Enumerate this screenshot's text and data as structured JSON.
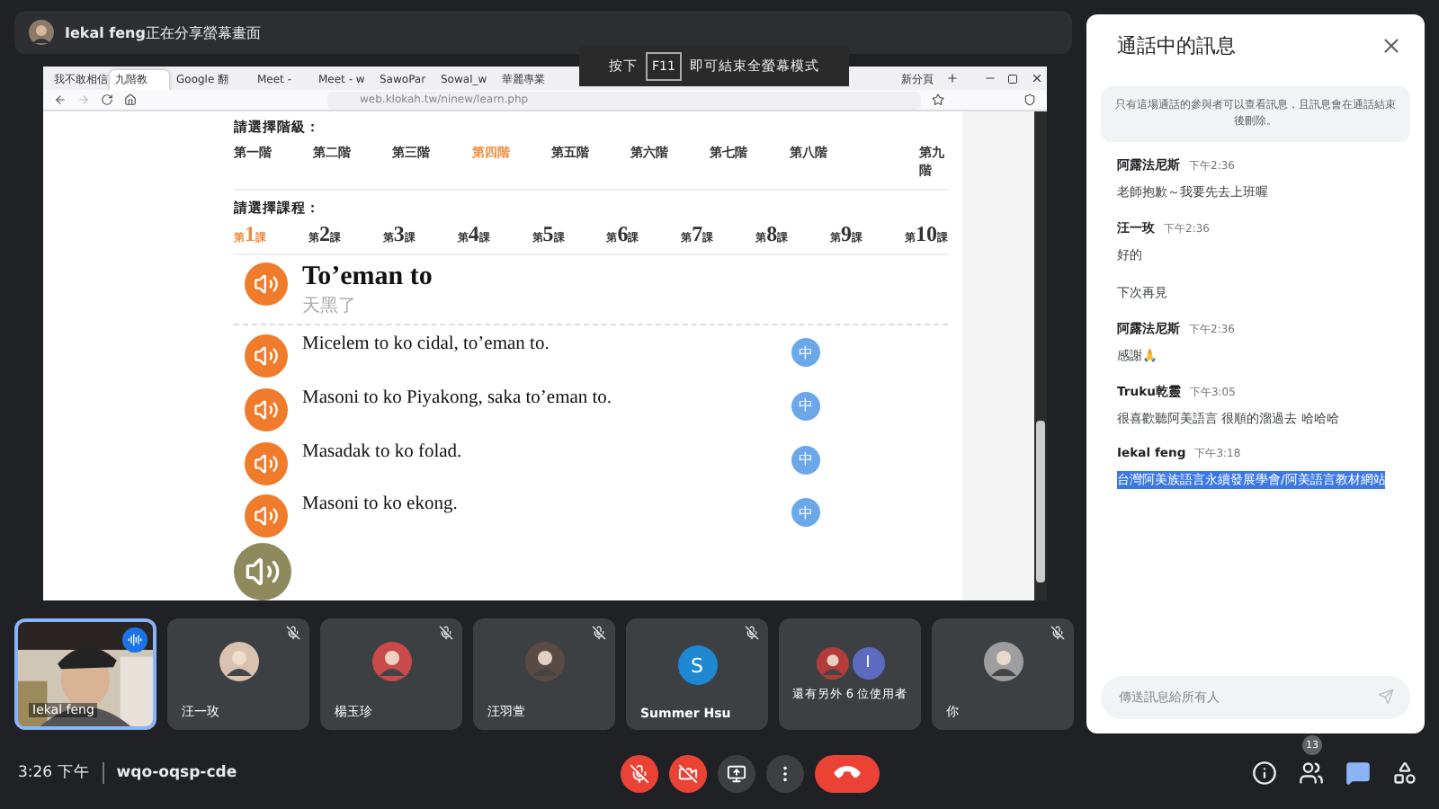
{
  "banner": {
    "text": "**Iekal feng**正在分享螢幕畫面"
  },
  "fullscreen_hint": {
    "before": "按下",
    "key": "F11",
    "after": "即可結束全螢幕模式"
  },
  "browser": {
    "tabs": [
      {
        "label": "我不敢相信",
        "selected": false
      },
      {
        "label": "九階教",
        "selected": true
      },
      {
        "label": "Google 翻",
        "selected": false
      },
      {
        "label": "Meet -",
        "selected": false
      },
      {
        "label": "Meet - w",
        "selected": false
      },
      {
        "label": "SawoPar",
        "selected": false
      },
      {
        "label": "Sowal_w",
        "selected": false
      },
      {
        "label": "華麗專業",
        "selected": false
      },
      {
        "label": "新分頁",
        "selected": false
      }
    ],
    "url": "web.klokah.tw/ninew/learn.php"
  },
  "lesson_page": {
    "level_prompt": "請選擇階級：",
    "levels": [
      {
        "label": "第一階",
        "selected": false
      },
      {
        "label": "第二階",
        "selected": false
      },
      {
        "label": "第三階",
        "selected": false
      },
      {
        "label": "第四階",
        "selected": true
      },
      {
        "label": "第五階",
        "selected": false
      },
      {
        "label": "第六階",
        "selected": false
      },
      {
        "label": "第七階",
        "selected": false
      },
      {
        "label": "第八階",
        "selected": false
      },
      {
        "label": "第九階",
        "selected": false
      }
    ],
    "course_prompt": "請選擇課程：",
    "courses": [
      {
        "label": "第1課",
        "selected": true
      },
      {
        "label": "第2課",
        "selected": false
      },
      {
        "label": "第3課",
        "selected": false
      },
      {
        "label": "第4課",
        "selected": false
      },
      {
        "label": "第5課",
        "selected": false
      },
      {
        "label": "第6課",
        "selected": false
      },
      {
        "label": "第7課",
        "selected": false
      },
      {
        "label": "第8課",
        "selected": false
      },
      {
        "label": "第9課",
        "selected": false
      },
      {
        "label": "第10課",
        "selected": false
      }
    ],
    "title": "To’eman to",
    "translation": "天黑了",
    "sentences": [
      {
        "text": "Micelem to ko cidal, to’eman to.",
        "translate": "中"
      },
      {
        "text": "Masoni to ko Piyakong, saka to’eman to.",
        "translate": "中"
      },
      {
        "text": "Masadak to ko folad.",
        "translate": "中"
      },
      {
        "text": "Masoni to ko ekong.",
        "translate": "中"
      }
    ]
  },
  "participants": [
    {
      "kind": "video",
      "name": "Iekal feng",
      "muted": false,
      "selected": true
    },
    {
      "name": "汪一玫",
      "muted": true,
      "selected": false,
      "color": "#d9c2b0"
    },
    {
      "name": "楊玉珍",
      "muted": true,
      "selected": false,
      "color": "#c94a4a"
    },
    {
      "name": "汪羽萱",
      "muted": true,
      "selected": false,
      "color": "#5a4a44"
    },
    {
      "kind": "initial",
      "name": "Summer Hsu",
      "initial": "S",
      "muted": true,
      "selected": false,
      "color": "#1e88d2"
    },
    {
      "kind": "group",
      "name": "還有另外 6 位使用者",
      "initial": "I",
      "muted": false,
      "selected": false,
      "color": "#5c6bc0"
    },
    {
      "name": "你",
      "muted": true,
      "selected": false,
      "color": "#9e9e9e"
    }
  ],
  "chat": {
    "title": "通話中的訊息",
    "notice": "只有這場通話的參與者可以查看訊息，且訊息會在通話結束後刪除。",
    "messages": [
      {
        "sender": "阿露法尼斯",
        "time": "下午2:36",
        "lines": [
          "老師抱歉～我要先去上班喔"
        ],
        "highlighted": false
      },
      {
        "sender": "汪一玫",
        "time": "下午2:36",
        "lines": [
          "好的",
          "下次再見"
        ],
        "highlighted": false
      },
      {
        "sender": "阿露法尼斯",
        "time": "下午2:36",
        "lines": [
          "感謝🙏"
        ],
        "highlighted": false
      },
      {
        "sender": "Truku乾靈",
        "time": "下午3:05",
        "lines": [
          "很喜歡聽阿美語言 很順的溜過去 哈哈哈"
        ],
        "highlighted": false
      },
      {
        "sender": "Iekal feng",
        "time": "下午3:18",
        "lines": [
          "台灣阿美族語言永續發展學會/阿美語言教材網站"
        ],
        "highlighted": true
      }
    ],
    "placeholder": "傳送訊息給所有人"
  },
  "footer": {
    "time": "3:26 下午",
    "meeting_code": "wqo-oqsp-cde",
    "controls": [
      {
        "kind": "mic",
        "on": false
      },
      {
        "kind": "camera",
        "on": false
      },
      {
        "kind": "present"
      },
      {
        "kind": "more"
      },
      {
        "kind": "hangup"
      }
    ],
    "side_buttons": [
      {
        "kind": "info",
        "selected": false
      },
      {
        "kind": "people",
        "badge": "13",
        "selected": false
      },
      {
        "kind": "chat",
        "selected": true
      },
      {
        "kind": "activities",
        "selected": false
      }
    ]
  }
}
